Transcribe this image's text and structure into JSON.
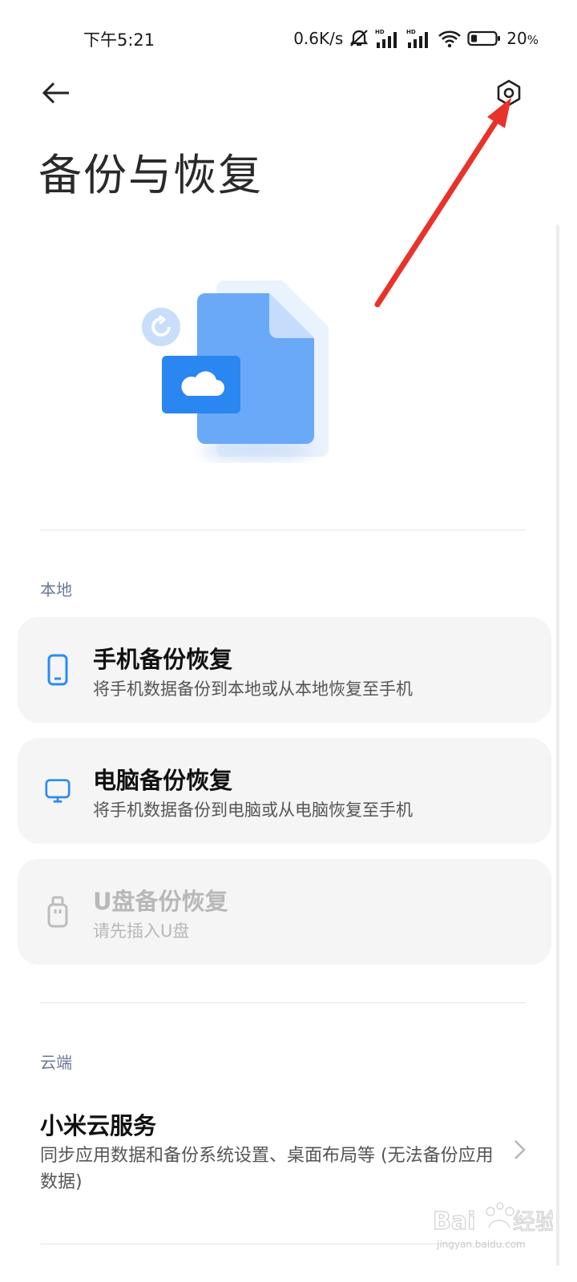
{
  "status_bar": {
    "time": "下午5:21",
    "net_speed": "0.6K/s",
    "battery_pct": "20",
    "battery_unit": "%",
    "icons": [
      "mute-bell-icon",
      "hd-signal-icon",
      "hd-signal-icon",
      "wifi-icon",
      "battery-icon"
    ]
  },
  "header": {
    "back_icon": "back-arrow-icon",
    "settings_icon": "gear-icon",
    "title": "备份与恢复"
  },
  "sections": {
    "local_label": "本地",
    "cloud_label": "云端"
  },
  "local_items": [
    {
      "icon": "phone-icon",
      "title": "手机备份恢复",
      "subtitle": "将手机数据备份到本地或从本地恢复至手机",
      "enabled": true
    },
    {
      "icon": "monitor-icon",
      "title": "电脑备份恢复",
      "subtitle": "将手机数据备份到电脑或从电脑恢复至手机",
      "enabled": true
    },
    {
      "icon": "usb-drive-icon",
      "title": "U盘备份恢复",
      "subtitle": "请先插入U盘",
      "enabled": false
    }
  ],
  "cloud_item": {
    "title": "小米云服务",
    "subtitle": "同步应用数据和备份系统设置、桌面布局等 (无法备份应用数据)",
    "icon": "chevron-right-icon"
  },
  "watermark": {
    "text": "jingyan.baidu.com"
  },
  "colors": {
    "accent": "#2a8af6",
    "card_bg": "#f5f5f5",
    "annotation": "#e8322a",
    "section_label": "#6a7894"
  }
}
